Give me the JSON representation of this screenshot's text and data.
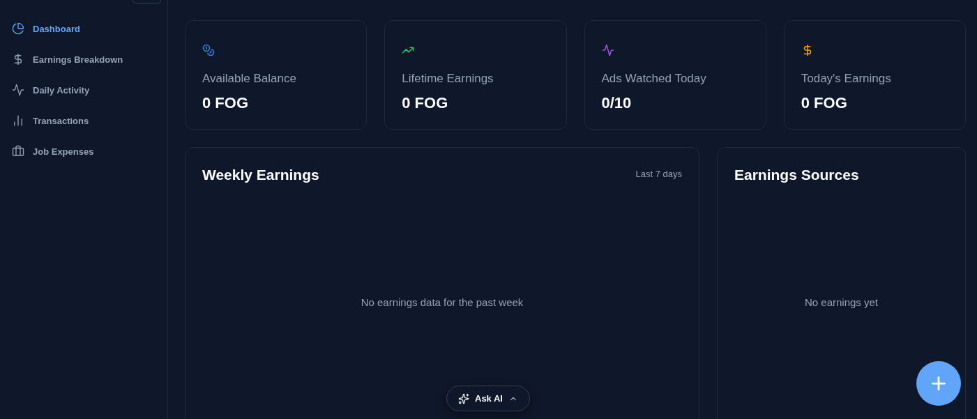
{
  "sidebar": {
    "items": [
      {
        "label": "Dashboard",
        "selected": true
      },
      {
        "label": "Earnings Breakdown",
        "selected": false
      },
      {
        "label": "Daily Activity",
        "selected": false
      },
      {
        "label": "Transactions",
        "selected": false
      },
      {
        "label": "Job Expenses",
        "selected": false
      }
    ]
  },
  "stats": [
    {
      "label": "Available Balance",
      "value": "0 FOG",
      "color": "#3b82f6"
    },
    {
      "label": "Lifetime Earnings",
      "value": "0 FOG",
      "color": "#22c55e"
    },
    {
      "label": "Ads Watched Today",
      "value": "0/10",
      "color": "#a855f7"
    },
    {
      "label": "Today's Earnings",
      "value": "0 FOG",
      "color": "#f59e0b"
    }
  ],
  "weekly_earnings": {
    "title": "Weekly Earnings",
    "range": "Last 7 days",
    "empty_message": "No earnings data for the past week"
  },
  "earnings_sources": {
    "title": "Earnings Sources",
    "empty_message": "No earnings yet"
  },
  "ask_ai": {
    "label": "Ask AI"
  }
}
